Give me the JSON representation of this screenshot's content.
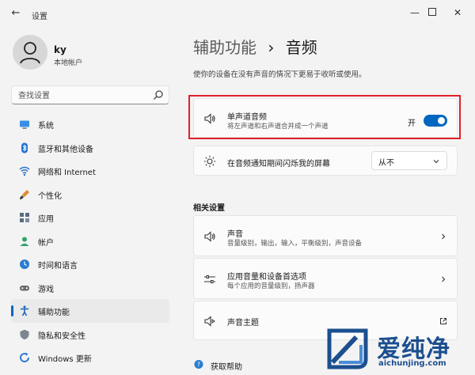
{
  "window": {
    "title": "设置"
  },
  "profile": {
    "name": "ky",
    "account_type": "本地帐户"
  },
  "search": {
    "placeholder": "查找设置"
  },
  "nav": {
    "items": [
      {
        "label": "系统",
        "icon": "monitor-icon"
      },
      {
        "label": "蓝牙和其他设备",
        "icon": "bluetooth-icon"
      },
      {
        "label": "网络和 Internet",
        "icon": "wifi-icon"
      },
      {
        "label": "个性化",
        "icon": "brush-icon"
      },
      {
        "label": "应用",
        "icon": "apps-icon"
      },
      {
        "label": "帐户",
        "icon": "account-icon"
      },
      {
        "label": "时间和语言",
        "icon": "clock-globe-icon"
      },
      {
        "label": "游戏",
        "icon": "gamepad-icon"
      },
      {
        "label": "辅助功能",
        "icon": "accessibility-icon",
        "active": true
      },
      {
        "label": "隐私和安全性",
        "icon": "shield-icon"
      },
      {
        "label": "Windows 更新",
        "icon": "update-icon"
      }
    ]
  },
  "page": {
    "breadcrumb_parent": "辅助功能",
    "separator": "›",
    "title": "音频",
    "description": "使你的设备在没有声音的情况下更易于收听或使用。"
  },
  "mono_audio": {
    "title": "单声道音频",
    "subtitle": "将左声道和右声道合并成一个声道",
    "toggle_state_label": "开",
    "enabled": true
  },
  "flash_screen": {
    "title": "在音频通知期间闪烁我的屏幕",
    "selected_option": "从不"
  },
  "related": {
    "heading": "相关设置",
    "items": [
      {
        "title": "声音",
        "subtitle": "音量级别，输出，输入，平衡级别，声音设备"
      },
      {
        "title": "应用音量和设备首选项",
        "subtitle": "每个应用的音量级别，扬声器"
      },
      {
        "title": "声音主题"
      }
    ]
  },
  "help": {
    "label": "获取帮助"
  },
  "watermark": {
    "text": "爱纯净",
    "url": "aichunjing.com"
  },
  "colors": {
    "accent": "#0067c0",
    "highlight_border": "#e0202a",
    "watermark": "#1c4f8f"
  }
}
